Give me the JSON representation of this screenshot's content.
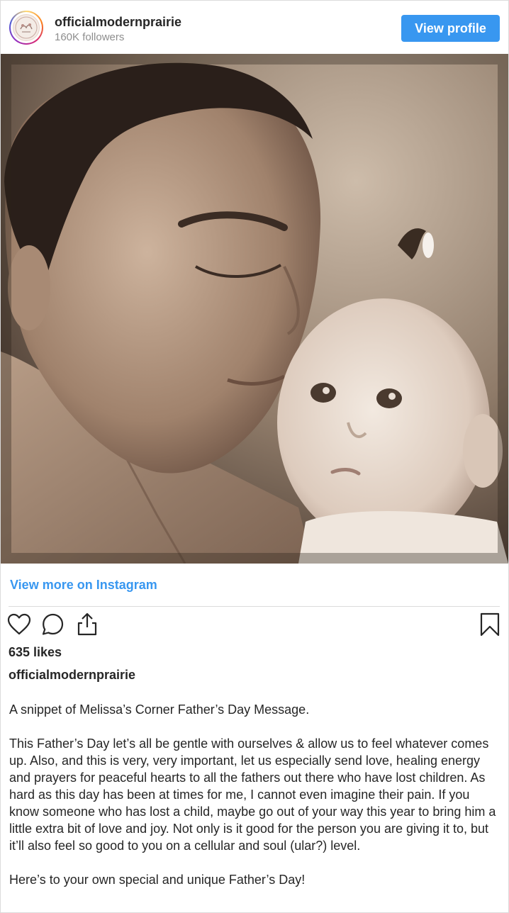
{
  "header": {
    "username": "officialmodernprairie",
    "followers": "160K followers",
    "view_profile_label": "View profile"
  },
  "links": {
    "view_more": "View more on Instagram"
  },
  "post": {
    "likes": "635 likes",
    "caption_username": "officialmodernprairie",
    "caption_paragraphs": [
      "A snippet of Melissa’s Corner Father’s Day Message.",
      "This Father’s Day let’s all be gentle with ourselves & allow us to feel whatever comes up. Also, and this is very, very important, let us especially send love, healing energy and prayers for peaceful hearts to all the fathers out there who have lost children. As hard as this day has been at times for me, I cannot even imagine their pain. If you know someone who has lost a child, maybe go out of your way this year to bring him a little extra bit of love and joy. Not only is it good for the person you are giving it to, but it’ll also feel so good to you on a cellular and soul (ular?) level.",
      "Here’s to your own special and unique Father’s Day!"
    ]
  },
  "icons": {
    "like": "heart-icon",
    "comment": "comment-icon",
    "share": "share-icon",
    "save": "bookmark-icon"
  },
  "colors": {
    "accent": "#3897f0",
    "text": "#262626",
    "muted": "#8e8e8e",
    "divider": "#dbdbdb"
  }
}
